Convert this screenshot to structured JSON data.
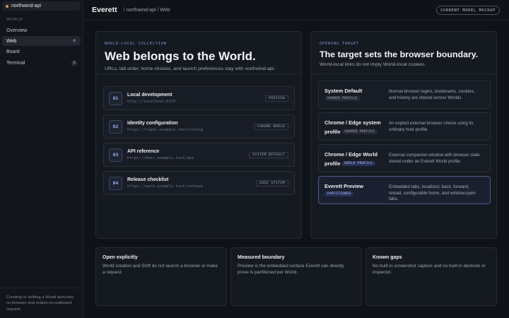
{
  "sidebar": {
    "workspace": "northwind-api",
    "section_label": "WORLD",
    "items": [
      {
        "label": "Overview",
        "badge": ""
      },
      {
        "label": "Web",
        "badge": "4"
      },
      {
        "label": "Board",
        "badge": ""
      },
      {
        "label": "Terminal",
        "badge": "3"
      }
    ],
    "footer": "Creating or shifting a World launches no browser and makes no outbound request."
  },
  "header": {
    "title": "Everett",
    "breadcrumb": "/ northwind-api / Web",
    "badge": "CURRENT MODEL MOCKUP"
  },
  "collection": {
    "eyebrow": "WORLD-LOCAL COLLECTION",
    "title": "Web belongs to the World.",
    "subtitle": "URLs, tab order, home choices, and launch preferences stay with northwind-api.",
    "links": [
      {
        "num": "01",
        "title": "Local development",
        "url": "http://localhost:5173",
        "tag": "PREVIEW"
      },
      {
        "num": "02",
        "title": "Identity configuration",
        "url": "https://login.example.test/config",
        "tag": "CHROME WORLD"
      },
      {
        "num": "03",
        "title": "API reference",
        "url": "https://docs.example.test/api",
        "tag": "SYSTEM DEFAULT"
      },
      {
        "num": "04",
        "title": "Release checklist",
        "url": "https://work.example.test/release",
        "tag": "EDGE SYSTEM"
      }
    ]
  },
  "target": {
    "eyebrow": "OPENING TARGET",
    "title": "The target sets the browser boundary.",
    "subtitle": "World-local links do not imply World-local cookies.",
    "options": [
      {
        "name": "System Default",
        "pill": "SHARED PROFILE",
        "desc": "Normal browser logins, bookmarks, cookies, and history are shared across Worlds."
      },
      {
        "name": "Chrome / Edge system profile",
        "pill": "SHARED PROFILE",
        "desc": "An explicit external browser choice using its ordinary host profile."
      },
      {
        "name": "Chrome / Edge World profile",
        "pill": "WORLD PROFILE",
        "desc": "External companion window with browser state stored under an Everett World profile."
      },
      {
        "name": "Everett Preview",
        "pill": "PARTITIONED",
        "desc": "Embedded tabs, localhost, back, forward, reload, configurable home, and window.open tabs."
      }
    ]
  },
  "notes": [
    {
      "title": "Open explicitly",
      "text": "World creation and Shift do not launch a browser or make a request."
    },
    {
      "title": "Measured boundary",
      "text": "Preview is the embedded surface Everett can directly prove is partitioned per World."
    },
    {
      "title": "Known gaps",
      "text": "No built-in screenshot capture and no built-in devtools or inspector."
    }
  ],
  "colors": {
    "background": "#0f1217",
    "accent": "#7f9bd6",
    "workspace_dot": "#d2a33c"
  }
}
